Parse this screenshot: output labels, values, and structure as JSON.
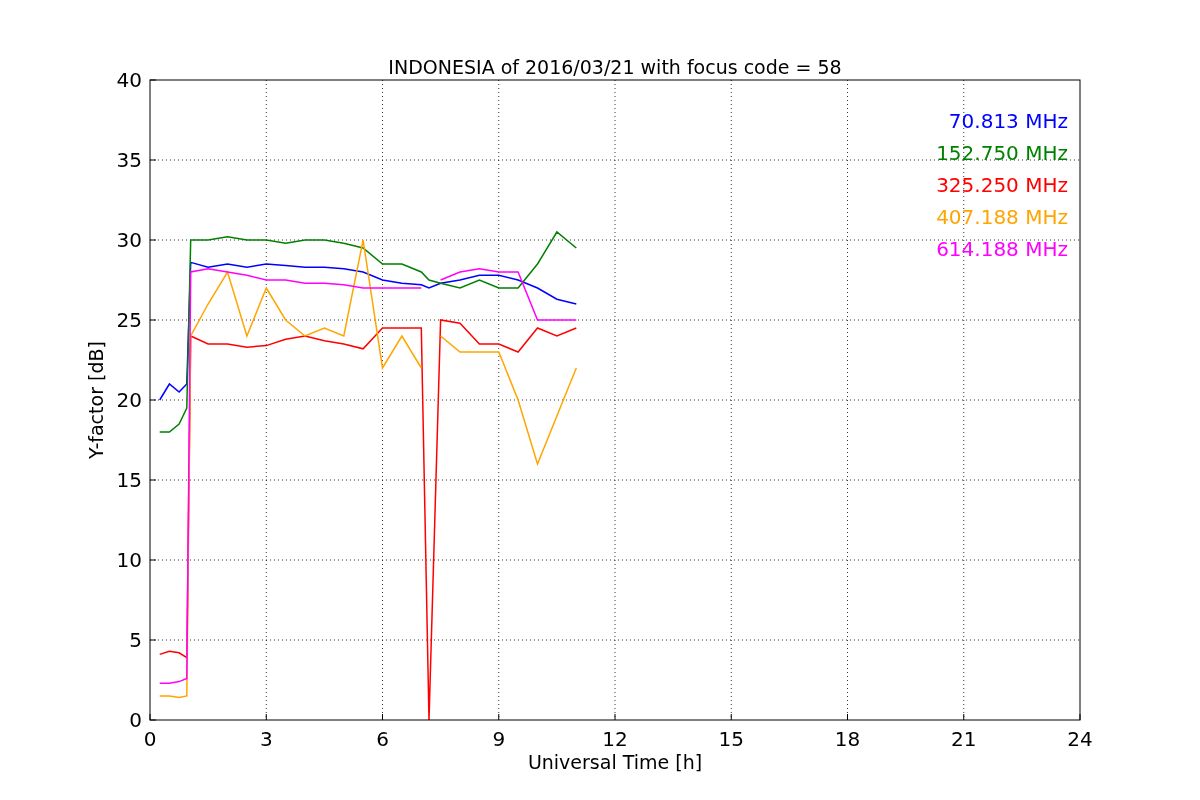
{
  "chart_data": {
    "type": "line",
    "title": "INDONESIA of 2016/03/21 with focus code = 58",
    "xlabel": "Universal Time [h]",
    "ylabel": "Y-factor [dB]",
    "x": [
      0.25,
      0.5,
      0.75,
      0.95,
      1.05,
      1.5,
      2,
      2.5,
      3,
      3.5,
      4,
      4.5,
      5,
      5.5,
      6,
      6.5,
      7,
      7.2,
      7.5,
      8,
      8.5,
      9,
      9.5,
      10,
      10.5,
      11
    ],
    "series": [
      {
        "name": "70.813 MHz",
        "color": "#0000ff",
        "values": [
          20,
          21,
          20.5,
          21,
          28.6,
          28.3,
          28.5,
          28.3,
          28.5,
          28.4,
          28.3,
          28.3,
          28.2,
          28,
          27.5,
          27.3,
          27.2,
          27,
          27.3,
          27.5,
          27.8,
          27.8,
          27.5,
          27,
          26.3,
          26
        ]
      },
      {
        "name": "152.750 MHz",
        "color": "#008000",
        "values": [
          18,
          18,
          18.5,
          19.5,
          30,
          30,
          30.2,
          30,
          30,
          29.8,
          30,
          30,
          29.8,
          29.5,
          28.5,
          28.5,
          28,
          27.5,
          27.3,
          27,
          27.5,
          27,
          27,
          28.5,
          30.5,
          29.5
        ]
      },
      {
        "name": "325.250 MHz",
        "color": "#ff0000",
        "values": [
          4.1,
          4.3,
          4.2,
          3.9,
          24,
          23.5,
          23.5,
          23.3,
          23.4,
          23.8,
          24,
          23.7,
          23.5,
          23.2,
          24.5,
          24.5,
          24.5,
          0,
          25,
          24.8,
          23.5,
          23.5,
          23,
          24.5,
          24,
          24.5
        ]
      },
      {
        "name": "407.188 MHz",
        "color": "#ffa500",
        "values": [
          1.5,
          1.5,
          1.4,
          1.5,
          24,
          26,
          28,
          24,
          27,
          25,
          24,
          24.5,
          24,
          30,
          22,
          24,
          22,
          null,
          24,
          23,
          23,
          23,
          20,
          16,
          19,
          22
        ]
      },
      {
        "name": "614.188 MHz",
        "color": "#ff00ff",
        "values": [
          2.3,
          2.3,
          2.4,
          2.6,
          28,
          28.2,
          28,
          27.8,
          27.5,
          27.5,
          27.3,
          27.3,
          27.2,
          27,
          27,
          27,
          27,
          null,
          27.5,
          28,
          28.2,
          28,
          28,
          25,
          25,
          25
        ]
      }
    ],
    "xlim": [
      0,
      24
    ],
    "ylim": [
      0,
      40
    ],
    "xticks": [
      0,
      3,
      6,
      9,
      12,
      15,
      18,
      21,
      24
    ],
    "yticks": [
      0,
      5,
      10,
      15,
      20,
      25,
      30,
      35,
      40
    ],
    "grid": true
  }
}
